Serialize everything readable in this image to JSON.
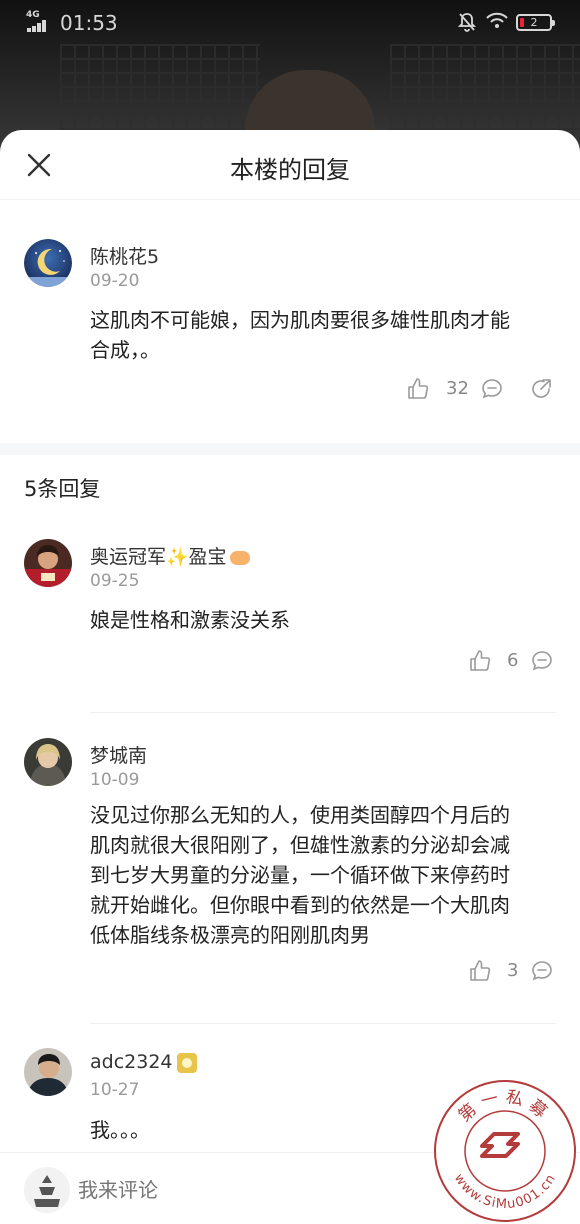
{
  "status_bar": {
    "network": "4G",
    "time": "01:53",
    "battery": "2"
  },
  "sheet": {
    "title": "本楼的回复"
  },
  "main_comment": {
    "author": "陈桃花5",
    "date": "09-20",
    "text_line1": "这肌肉不可能娘，因为肌肉要很多雄性肌肉才能",
    "text_line2": "合成，。",
    "likes": "32"
  },
  "replies_header": "5条回复",
  "replies": [
    {
      "author": "奥运冠军",
      "author_suffix": "盈宝",
      "date": "09-25",
      "lines": [
        "娘是性格和激素没关系"
      ],
      "likes": "6"
    },
    {
      "author": "梦城南",
      "date": "10-09",
      "lines": [
        "没见过你那么无知的人，使用类固醇四个月后的",
        "肌肉就很大很阳刚了，但雄性激素的分泌却会减",
        "到七岁大男童的分泌量，一个循环做下来停药时",
        "就开始雌化。但你眼中看到的依然是一个大肌肉",
        "低体脂线条极漂亮的阳刚肌肉男"
      ],
      "likes": "3"
    },
    {
      "author": "adc2324",
      "date": "10-27",
      "lines": [
        "我。。。"
      ]
    }
  ],
  "input": {
    "placeholder": "我来评论"
  },
  "watermark": {
    "top_text": "第一私募",
    "bottom_text": "www.SiMu001.cn"
  },
  "colors": {
    "text_primary": "#222222",
    "text_secondary": "#9a9a9a",
    "icon_gray": "#9a9a9a"
  }
}
